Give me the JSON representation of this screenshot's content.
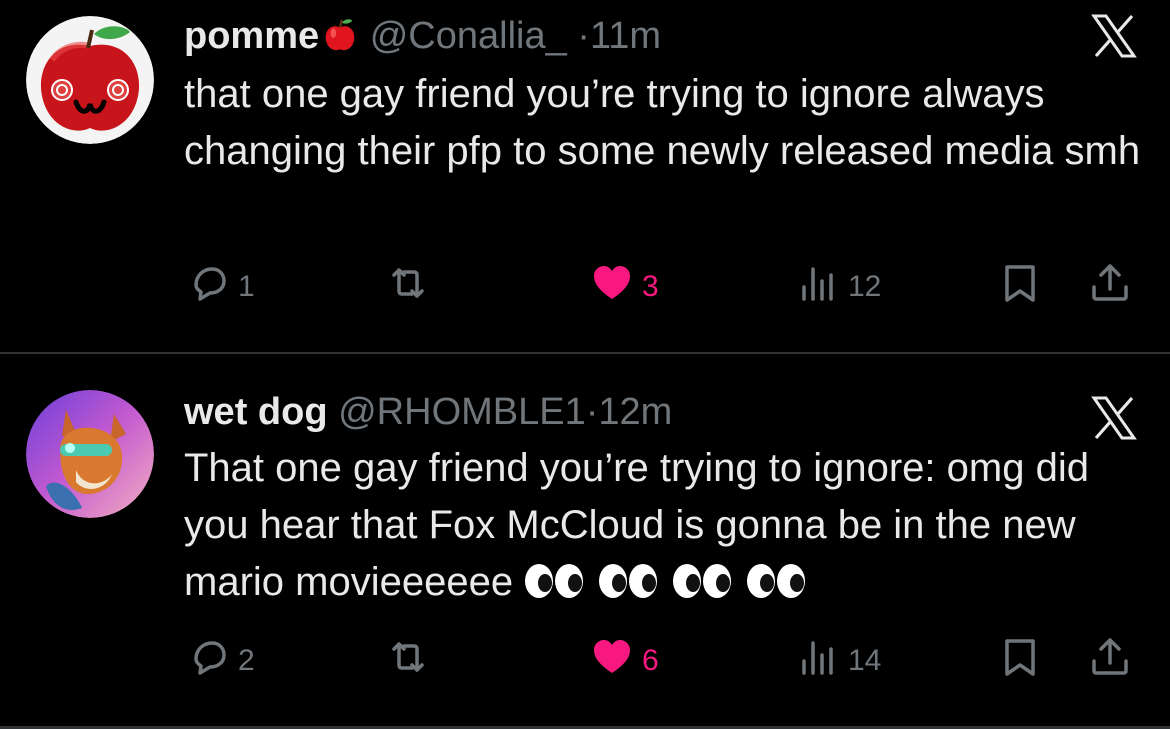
{
  "tweets": [
    {
      "display_name": "pomme",
      "name_emoji": "apple-emoji",
      "handle": "@Conallia_",
      "separator": "·",
      "time": "11m",
      "text": "that one gay friend you’re trying to ignore always changing their pfp to some newly released media smh",
      "reply_count": "1",
      "like_count": "3",
      "view_count": "12",
      "liked": true
    },
    {
      "display_name": "wet dog",
      "handle": "@RHOMBLE1",
      "separator": "·",
      "time": "12m",
      "text": "That one gay friend you’re trying to ignore: omg did you hear that Fox McCloud is gonna be in the new mario movieeeeee",
      "trailing_emoji": [
        "eyes-emoji",
        "eyes-emoji",
        "eyes-emoji",
        "eyes-emoji"
      ],
      "reply_count": "2",
      "like_count": "6",
      "view_count": "14",
      "liked": true
    }
  ],
  "colors": {
    "background": "#000000",
    "text": "#e7e9ea",
    "secondary": "#71767b",
    "like": "#f91880",
    "divider": "#2f3336"
  },
  "icons": [
    "x-logo-icon",
    "reply-icon",
    "retweet-icon",
    "heart-icon",
    "views-icon",
    "bookmark-icon",
    "share-icon"
  ]
}
